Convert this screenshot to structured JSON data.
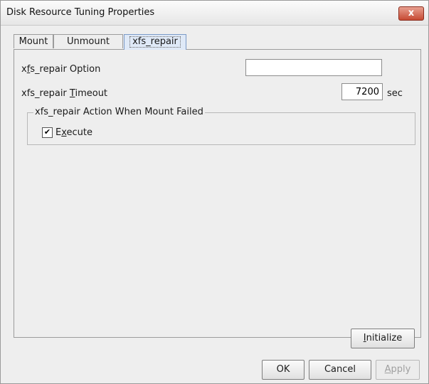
{
  "window": {
    "title": "Disk Resource Tuning Properties",
    "close_label": "x"
  },
  "tabs": [
    {
      "label": "Mount",
      "active": false
    },
    {
      "label": "Unmount",
      "active": false
    },
    {
      "label": "xfs_repair",
      "active": true
    }
  ],
  "xfs_repair_option": {
    "label_pre": "x",
    "label_accel": "f",
    "label_post": "s_repair Option",
    "value": ""
  },
  "xfs_repair_timeout": {
    "label_pre": "xfs_repair ",
    "label_accel": "T",
    "label_post": "imeout",
    "value": "7200",
    "unit": "sec"
  },
  "action_group": {
    "legend": "xfs_repair Action When Mount Failed",
    "execute_checked": true,
    "check_glyph": "✔",
    "execute_pre": "E",
    "execute_accel": "x",
    "execute_post": "ecute"
  },
  "buttons": {
    "initialize_accel": "I",
    "initialize_rest": "nitialize",
    "ok": "OK",
    "cancel": "Cancel",
    "apply_accel": "A",
    "apply_rest": "pply",
    "apply_enabled": false
  }
}
